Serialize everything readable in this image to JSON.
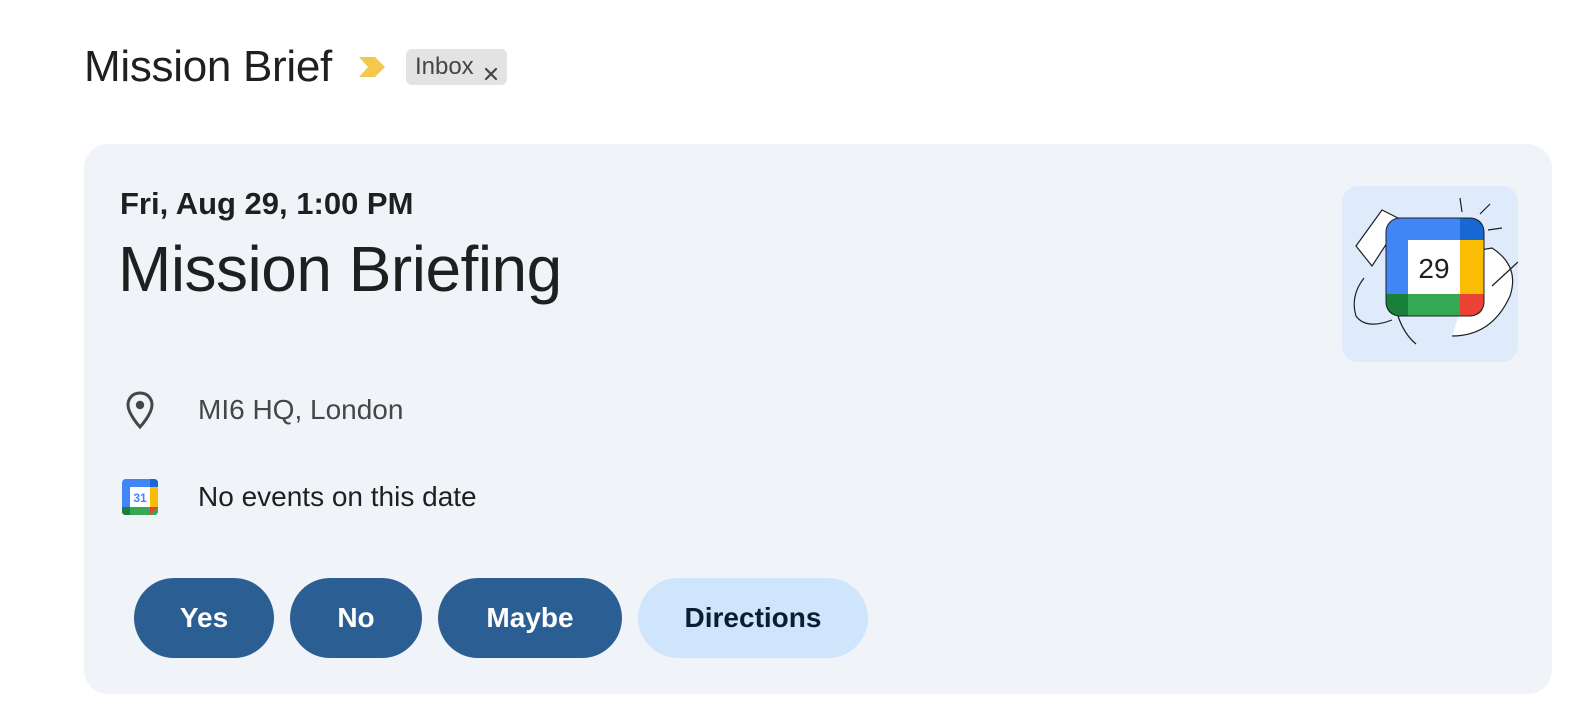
{
  "subject": {
    "title": "Mission Brief",
    "importance_icon": "importance-marker-icon",
    "importance_color": "#f2c94c",
    "label": {
      "text": "Inbox",
      "remove_icon": "close-icon"
    }
  },
  "event": {
    "date": "Fri, Aug 29, 1:00 PM",
    "title": "Mission Briefing",
    "illustration": {
      "icon": "calendar-illustration-icon",
      "day": "29"
    },
    "location": {
      "icon": "location-pin-icon",
      "text": "MI6 HQ, London"
    },
    "calendar": {
      "icon": "google-calendar-icon",
      "icon_day": "31",
      "text": "No events on this date"
    },
    "actions": {
      "yes": "Yes",
      "no": "No",
      "maybe": "Maybe",
      "directions": "Directions"
    }
  },
  "colors": {
    "card_background": "#f0f4f9",
    "primary_button": "#2b5f93",
    "secondary_button": "#cfe5fb",
    "label_chip": "#e3e3e3"
  }
}
